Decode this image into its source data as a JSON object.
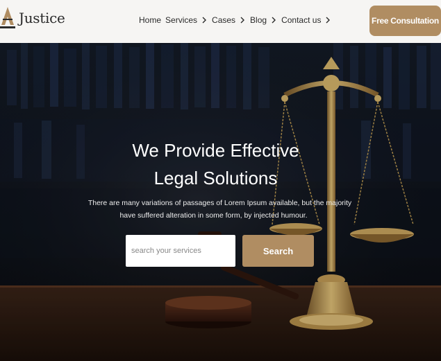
{
  "brand": {
    "name": "Justice",
    "logo_icon": "scales-icon"
  },
  "nav": {
    "items": [
      {
        "label": "Home",
        "has_chevron": false
      },
      {
        "label": "Services",
        "has_chevron": true
      },
      {
        "label": "Cases",
        "has_chevron": true
      },
      {
        "label": "Blog",
        "has_chevron": true
      },
      {
        "label": "Contact us",
        "has_chevron": true
      }
    ]
  },
  "cta": {
    "label": "Free Consultation"
  },
  "hero": {
    "title_line1": "We Provide Effective",
    "title_line2": "Legal Solutions",
    "subtitle_line1": "There are many variations of passages of Lorem Ipsum available, but the majority",
    "subtitle_line2": "have suffered alteration in some form, by injected humour.",
    "search_placeholder": "search your services",
    "search_button": "Search",
    "background_image": "scales-of-justice-and-gavel"
  },
  "colors": {
    "accent": "#b08d62",
    "header_bg": "#f6f5f3",
    "text_dark": "#2a2a2a"
  }
}
